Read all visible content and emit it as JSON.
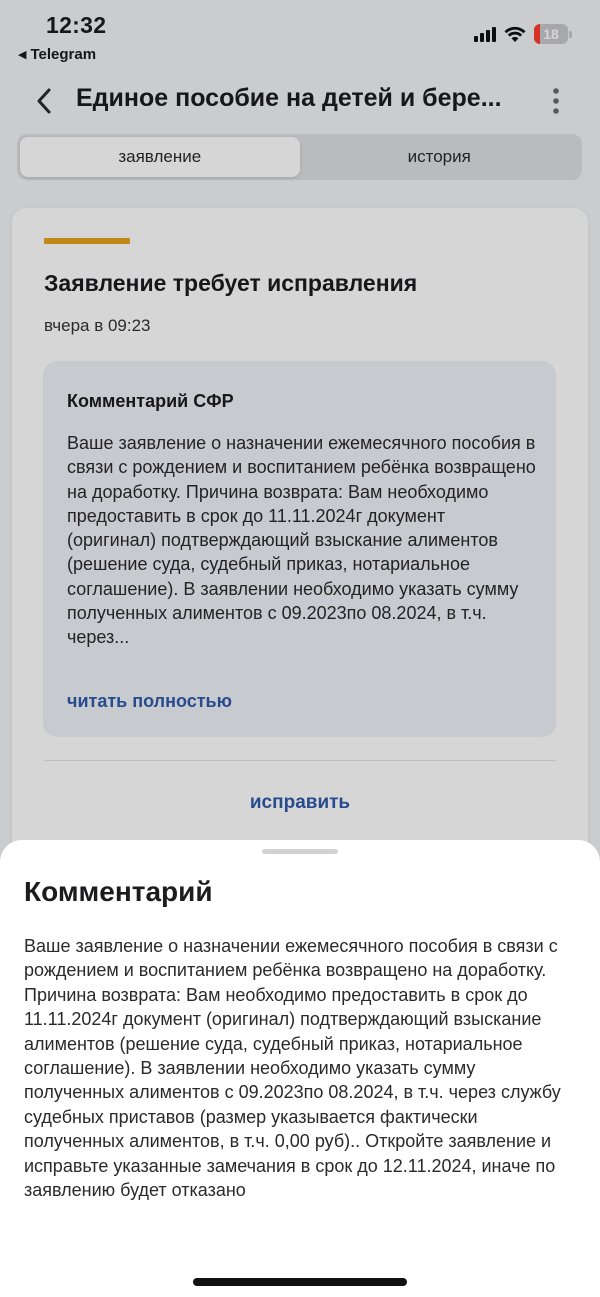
{
  "status_bar": {
    "time": "12:32",
    "back_app": "Telegram",
    "back_icon": "triangle-left-icon",
    "battery_level": "18",
    "battery_fill_percent": 18,
    "icons": [
      "signal-icon",
      "wifi-icon",
      "battery-icon"
    ]
  },
  "header": {
    "back_icon": "chevron-left-icon",
    "title": "Единое пособие на детей и бере...",
    "menu_icon": "more-vertical-icon"
  },
  "tabs": [
    {
      "label": "заявление",
      "active": true
    },
    {
      "label": "история",
      "active": false
    }
  ],
  "card": {
    "accent_color": "#e8a21c",
    "title": "Заявление требует исправления",
    "date": "вчера в 09:23",
    "comment": {
      "title": "Комментарий СФР",
      "text": "Ваше заявление о назначении ежемесячного пособия в связи с рождением и воспитанием ребёнка возвращено на доработку. Причина возврата: Вам необходимо предоставить в срок до 11.11.2024г документ (оригинал) подтверждающий взыскание алиментов (решение суда, судебный приказ, нотариальное соглашение). В заявлении необходимо указать сумму полученных алиментов с 09.2023по 08.2024, в т.ч. через...",
      "read_more": "читать полностью"
    },
    "fix_label": "исправить"
  },
  "sheet": {
    "title": "Комментарий",
    "text": "Ваше заявление о назначении ежемесячного пособия в связи с рождением и воспитанием ребёнка возвращено на доработку. Причина возврата: Вам необходимо предоставить в срок до 11.11.2024г документ (оригинал) подтверждающий взыскание алиментов (решение суда, судебный приказ, нотариальное соглашение). В заявлении необходимо указать сумму полученных алиментов с 09.2023по 08.2024, в т.ч. через службу судебных приставов (размер указывается фактически полученных алиментов, в т.ч. 0,00 руб).. Откройте заявление и исправьте указанные замечания в срок до 12.11.2024, иначе по заявлению будет отказано"
  },
  "colors": {
    "link": "#2f5aa8",
    "accent": "#e8a21c",
    "battery_low": "#ff3b30"
  }
}
